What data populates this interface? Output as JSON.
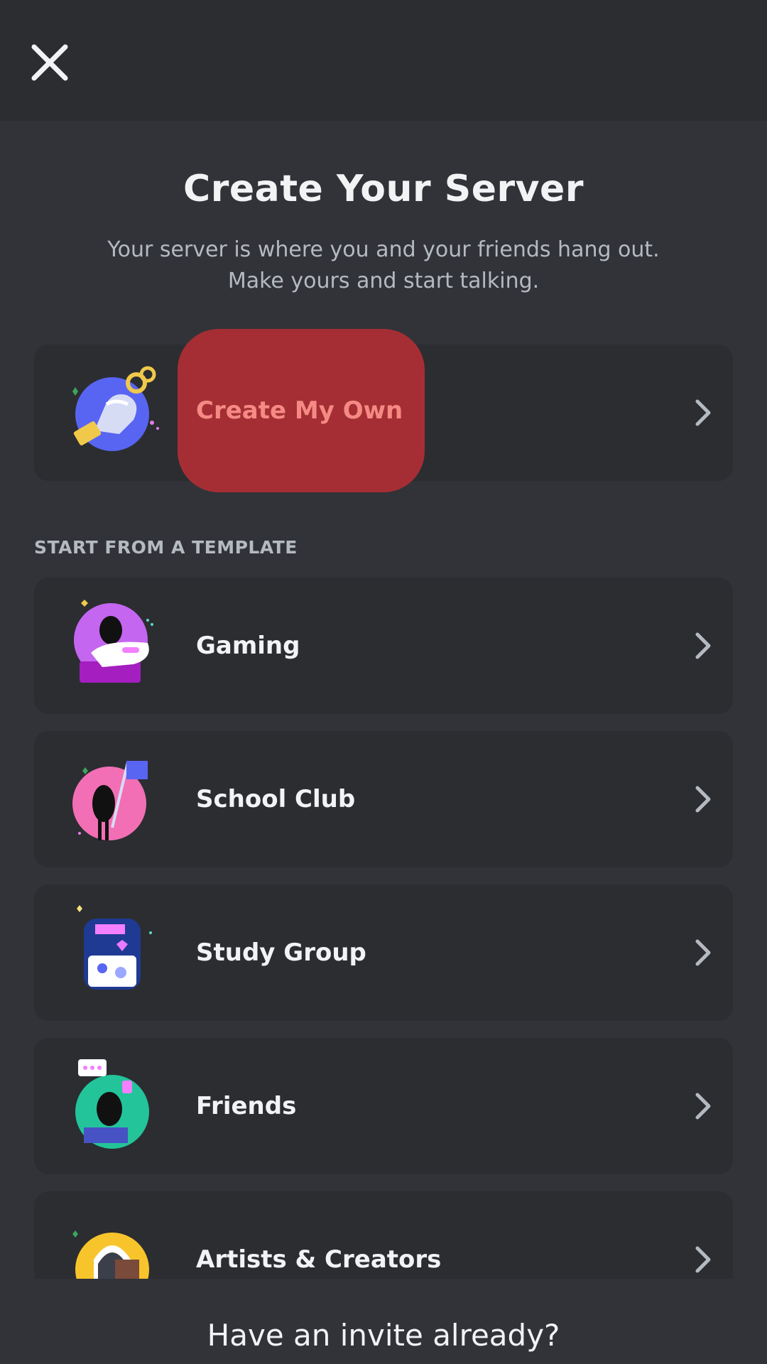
{
  "header": {
    "close_icon": "close-icon",
    "title": "Create Your Server",
    "subtitle_line1": "Your server is where you and your friends hang out.",
    "subtitle_line2": "Make yours and start talking."
  },
  "create_own": {
    "label": "Create My Own",
    "icon": "create-own-illustration-icon",
    "chevron": "chevron-right-icon",
    "highlight_color": "#a52e34"
  },
  "templates": {
    "header": "START FROM A TEMPLATE",
    "items": [
      {
        "label": "Gaming",
        "icon": "gaming-illustration-icon"
      },
      {
        "label": "School Club",
        "icon": "school-club-illustration-icon"
      },
      {
        "label": "Study Group",
        "icon": "study-group-illustration-icon"
      },
      {
        "label": "Friends",
        "icon": "friends-illustration-icon"
      },
      {
        "label": "Artists & Creators",
        "icon": "artists-illustration-icon"
      }
    ]
  },
  "footer": {
    "invite_label": "Have an invite already?"
  },
  "colors": {
    "background": "#313338",
    "card": "#2b2d31",
    "text": "#f2f3f5",
    "muted": "#b5bac1"
  }
}
